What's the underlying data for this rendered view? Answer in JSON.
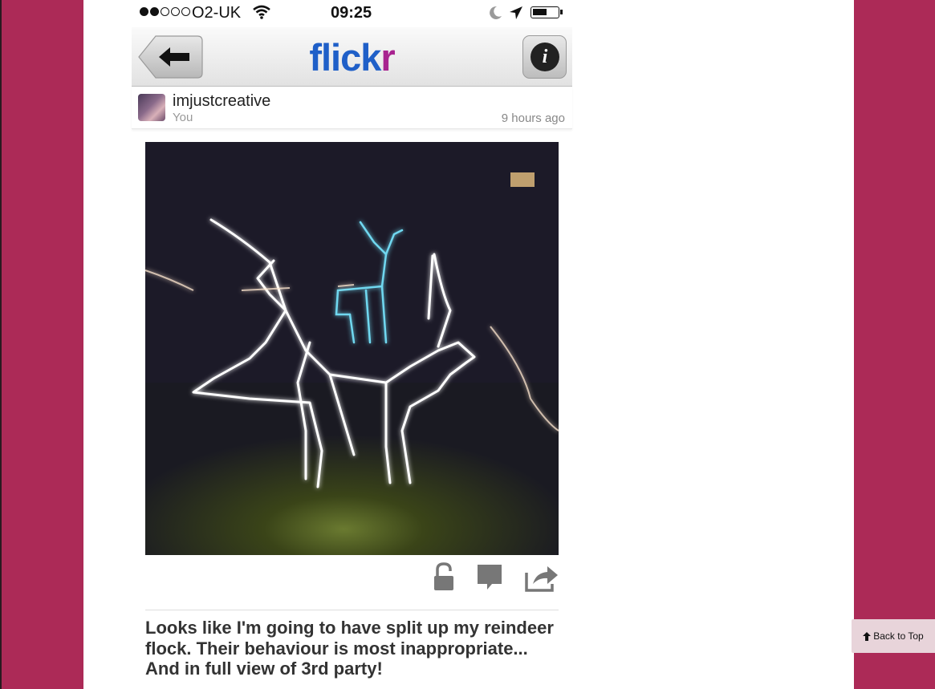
{
  "statusbar": {
    "carrier": "O2-UK",
    "time": "09:25",
    "signal_bars_filled": 2,
    "signal_bars_total": 5
  },
  "navbar": {
    "logo_part1": "flick",
    "logo_part2": "r",
    "back_icon": "back-arrow-icon",
    "info_icon": "info-icon",
    "logo_colors": [
      "#1f5fc8",
      "#a8238f"
    ]
  },
  "post": {
    "username": "imjustcreative",
    "owner_label": "You",
    "timestamp": "9 hours ago",
    "caption": "Looks like I'm going to have split up my reindeer flock. Their behaviour is most inappropriate... And in full view of 3rd party!",
    "actions": [
      "lock-icon",
      "comment-icon",
      "share-icon"
    ]
  },
  "page": {
    "back_to_top": "Back to Top",
    "background_color": "#ac2a57"
  }
}
